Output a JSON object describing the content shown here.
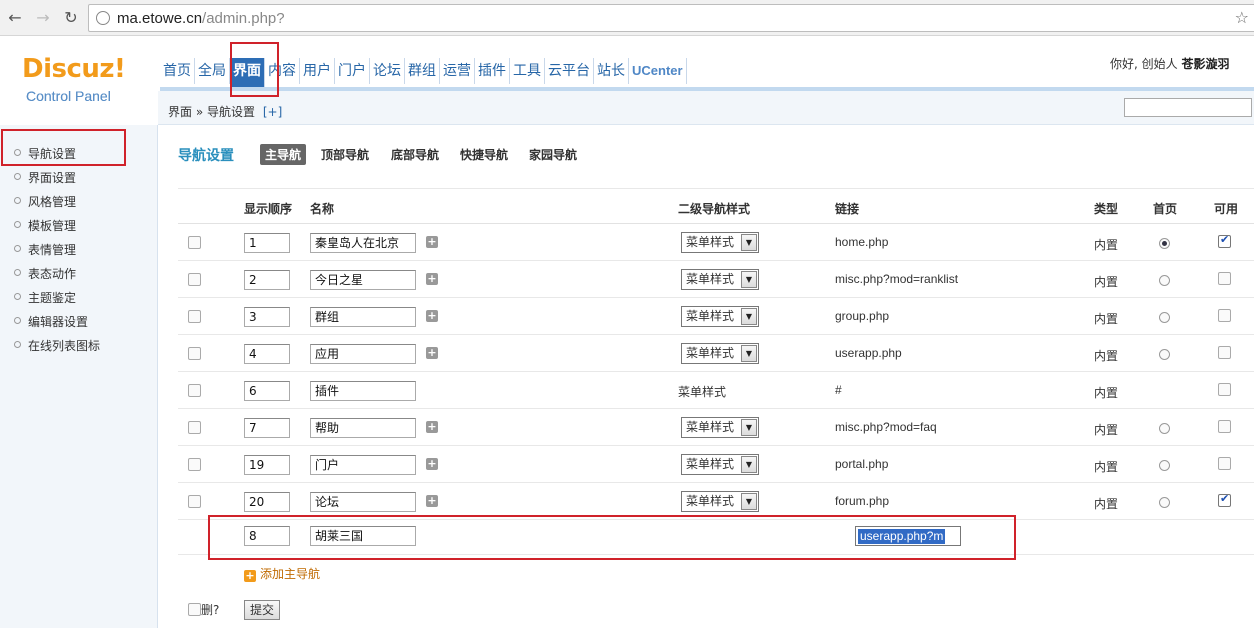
{
  "browser": {
    "url_host": "ma.etowe.cn",
    "url_path": "/admin.php?",
    "back_icon": "arrow-left",
    "forward_icon": "arrow-right",
    "reload_icon": "reload"
  },
  "logo": {
    "text": "Discuz!",
    "subtitle": "Control Panel"
  },
  "topnav": [
    "首页",
    "全局",
    "界面",
    "内容",
    "用户",
    "门户",
    "论坛",
    "群组",
    "运营",
    "插件",
    "工具",
    "云平台",
    "站长",
    "UCenter"
  ],
  "topnav_active": "界面",
  "user": {
    "greeting": "你好, 创始人",
    "name": "苍影漩羽"
  },
  "breadcrumb": {
    "root": "界面",
    "sep": "»",
    "current": "导航设置",
    "plus": "[+]"
  },
  "sidebar": [
    "导航设置",
    "界面设置",
    "风格管理",
    "模板管理",
    "表情管理",
    "表态动作",
    "主题鉴定",
    "编辑器设置",
    "在线列表图标"
  ],
  "page_title": "导航设置",
  "tabs": [
    "主导航",
    "顶部导航",
    "底部导航",
    "快捷导航",
    "家园导航"
  ],
  "columns": {
    "order": "显示顺序",
    "name": "名称",
    "style": "二级导航样式",
    "link": "链接",
    "type": "类型",
    "home": "首页",
    "enabled": "可用"
  },
  "rows": [
    {
      "order": "1",
      "name": "秦皇岛人在北京",
      "style": "菜单样式",
      "link": "home.php",
      "type": "内置"
    },
    {
      "order": "2",
      "name": "今日之星",
      "style": "菜单样式",
      "link": "misc.php?mod=ranklist",
      "type": "内置"
    },
    {
      "order": "3",
      "name": "群组",
      "style": "菜单样式",
      "link": "group.php",
      "type": "内置"
    },
    {
      "order": "4",
      "name": "应用",
      "style": "菜单样式",
      "link": "userapp.php",
      "type": "内置"
    },
    {
      "order": "6",
      "name": "插件",
      "style": "菜单样式",
      "link": "#",
      "type": "内置"
    },
    {
      "order": "7",
      "name": "帮助",
      "style": "菜单样式",
      "link": "misc.php?mod=faq",
      "type": "内置"
    },
    {
      "order": "19",
      "name": "门户",
      "style": "菜单样式",
      "link": "portal.php",
      "type": "内置"
    },
    {
      "order": "20",
      "name": "论坛",
      "style": "菜单样式",
      "link": "forum.php",
      "type": "内置"
    }
  ],
  "new_row": {
    "order": "8",
    "name": "胡莱三国",
    "link": "userapp.php?m"
  },
  "add_main_nav": "添加主导航",
  "delete_label": "删?",
  "submit": "提交",
  "colors": {
    "accent": "#2d6db5",
    "logo": "#f29b1b",
    "title": "#2a8fbd",
    "annotation": "#d0222a"
  }
}
